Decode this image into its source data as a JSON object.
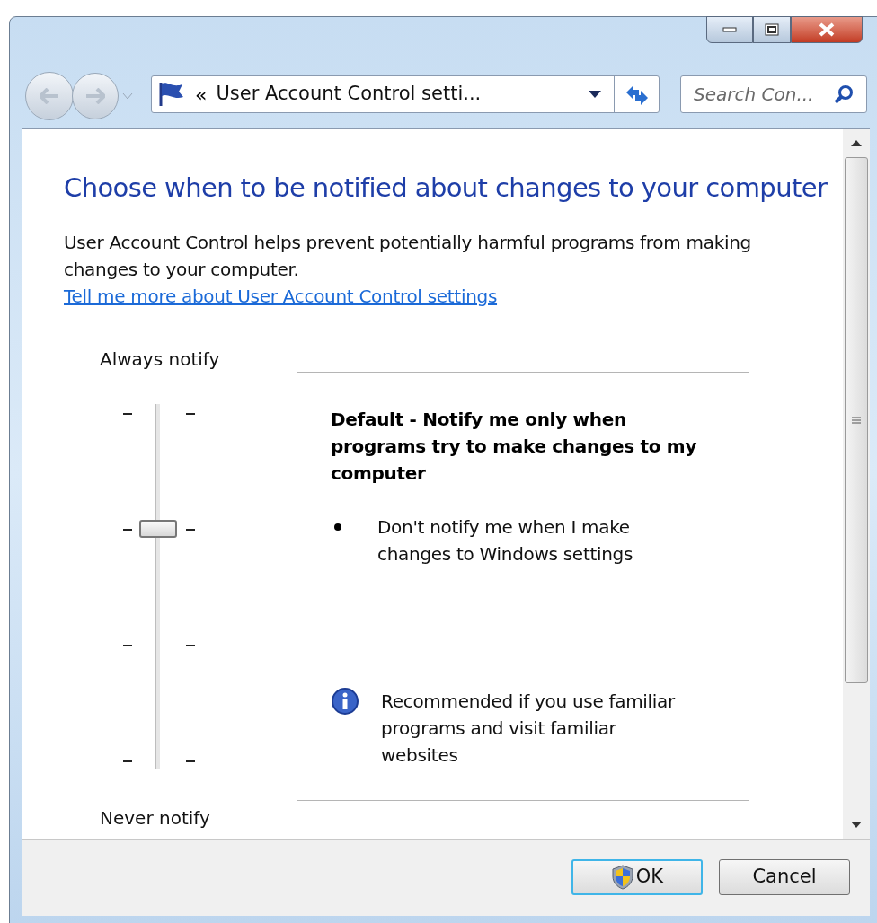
{
  "window": {
    "controls": [
      {
        "kind": "minimize"
      },
      {
        "kind": "maximize"
      },
      {
        "kind": "close"
      }
    ]
  },
  "address_bar": {
    "breadcrumb_prefix": "«",
    "path": "User Account Control setti..."
  },
  "search": {
    "placeholder": "Search Con..."
  },
  "heading": "Choose when to be notified about changes to your computer",
  "description": "User Account Control helps prevent potentially harmful programs from making changes to your computer.",
  "link": "Tell me more about User Account Control settings",
  "slider": {
    "top_label": "Always notify",
    "bottom_label": "Never notify",
    "level": 0.667
  },
  "info_panel": {
    "title": "Default - Notify me only when programs try to make changes to my computer",
    "bullets": [
      "Don't notify me when I make changes to Windows settings"
    ],
    "note": "Recommended if you use familiar programs and visit familiar websites"
  },
  "buttons": [
    {
      "label": "OK",
      "kind": "shield"
    },
    {
      "label": "Cancel",
      "kind": "plain"
    }
  ]
}
